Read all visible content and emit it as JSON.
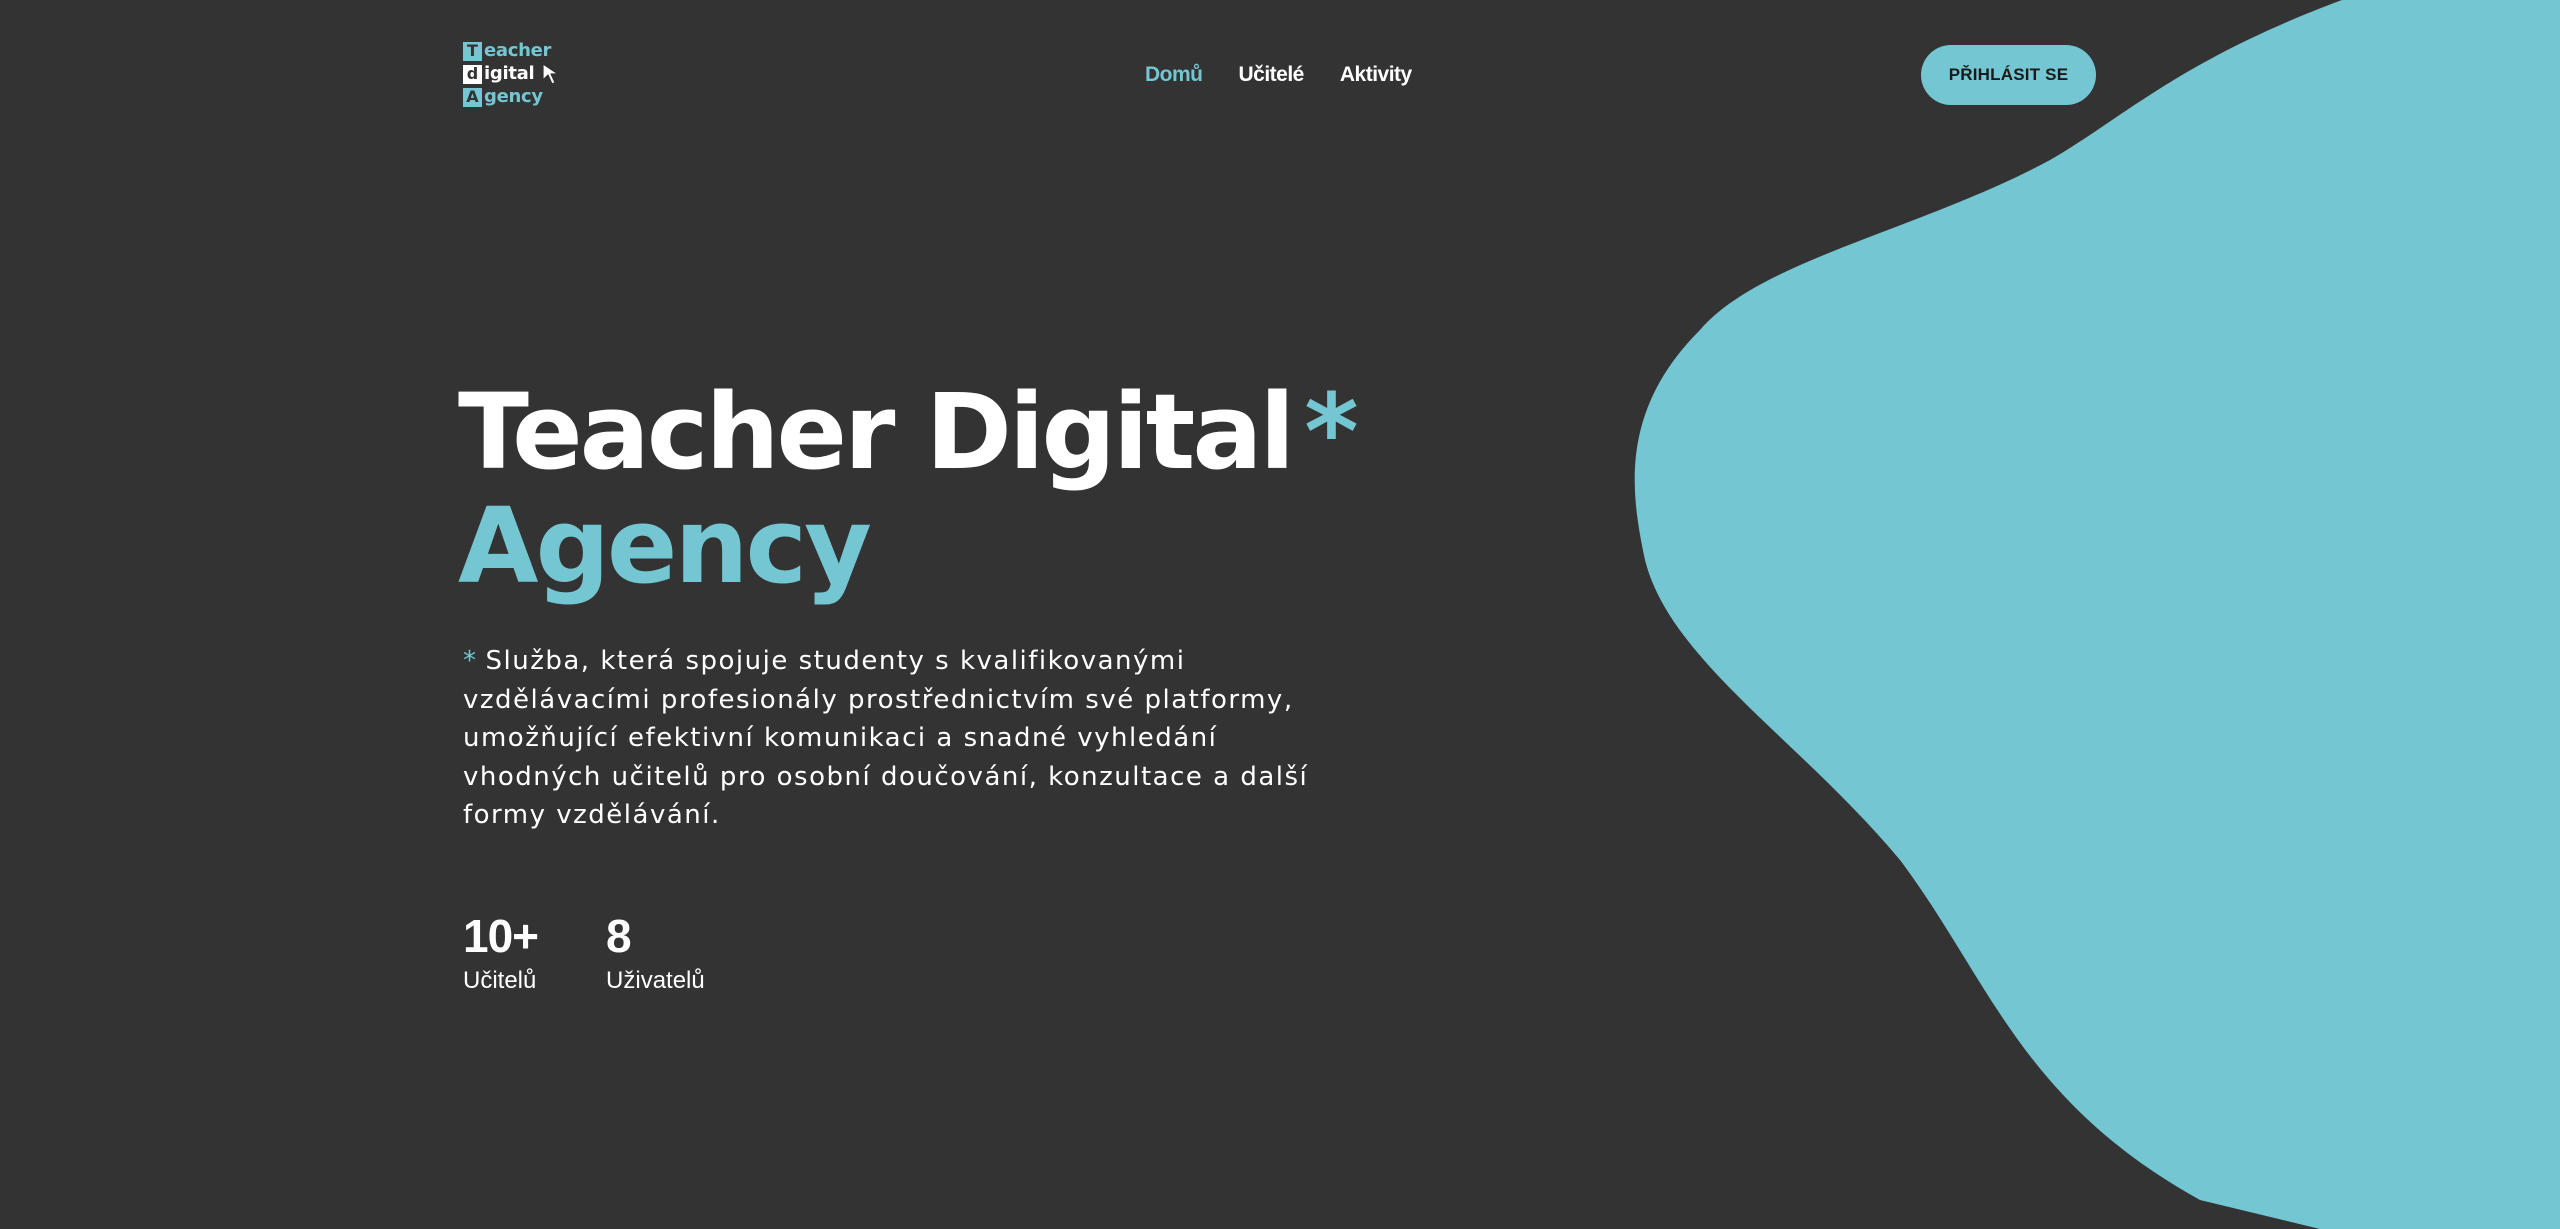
{
  "logo": {
    "line1_letter": "T",
    "line1_rest": "eacher",
    "line2_letter": "d",
    "line2_rest": "igital",
    "line3_letter": "A",
    "line3_rest": "gency"
  },
  "nav": {
    "items": [
      {
        "label": "Domů",
        "active": true
      },
      {
        "label": "Učitelé",
        "active": false
      },
      {
        "label": "Aktivity",
        "active": false
      }
    ]
  },
  "header": {
    "login_label": "PŘIHLÁSIT SE"
  },
  "hero": {
    "title_line1": "Teacher Digital",
    "title_asterisk": "*",
    "title_line2": "Agency",
    "description_star": "*",
    "description": "Služba, která spojuje studenty s kvalifikovanými vzdělávacími profesionály prostřednictvím své platformy, umožňující efektivní komunikaci a snadné vyhledání vhodných učitelů pro osobní doučování, konzultace a další formy vzdělávání."
  },
  "stats": [
    {
      "value": "10+",
      "label": "Učitelů"
    },
    {
      "value": "8",
      "label": "Uživatelů"
    }
  ],
  "colors": {
    "background": "#333333",
    "accent": "#73c6d2",
    "text": "#ffffff"
  },
  "icons": {
    "logo_cursor": "cursor-arrow-icon"
  }
}
